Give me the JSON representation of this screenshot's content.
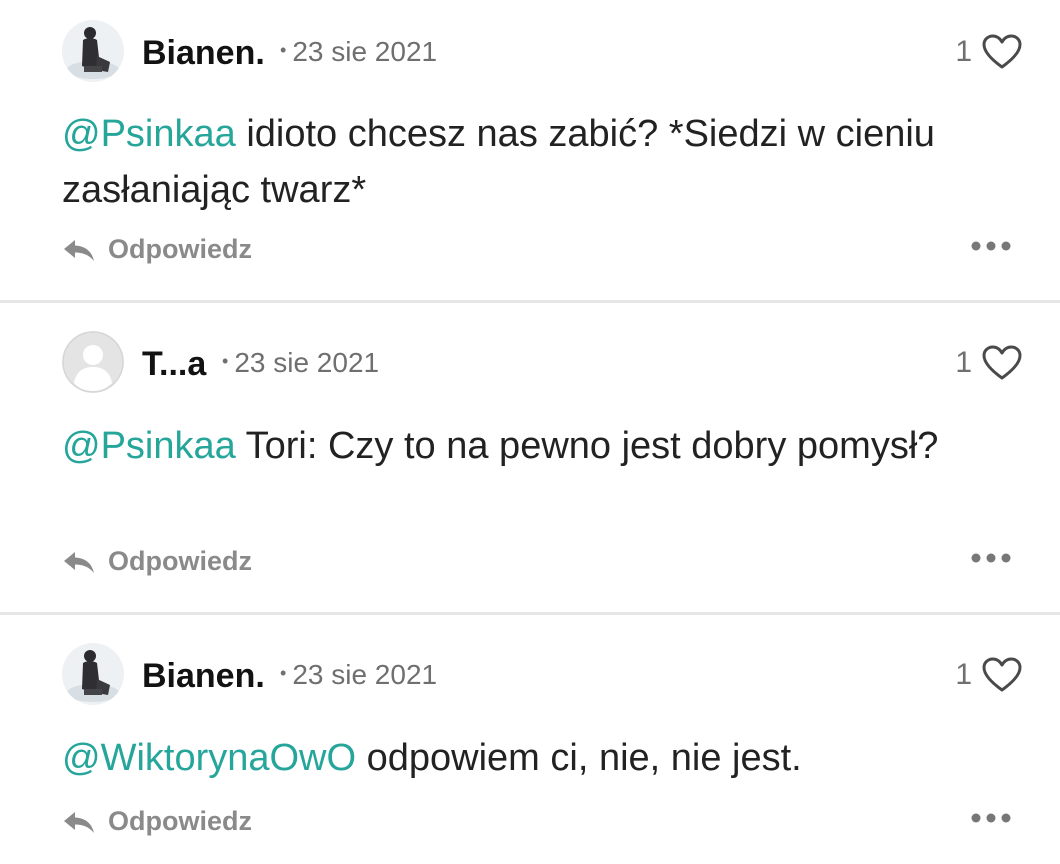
{
  "comments": [
    {
      "username": "Bianen.",
      "separator": "•",
      "date": "23 sie 2021",
      "likes": "1",
      "mention": "@Psinkaa",
      "text": " idioto chcesz nas zabić? *Siedzi w cieniu zasłaniając twarz*",
      "reply_label": "Odpowiedz",
      "avatar_icon": "user-photo-avatar-icon"
    },
    {
      "username": "T...a",
      "separator": "•",
      "date": "23 sie 2021",
      "likes": "1",
      "mention": "@Psinkaa",
      "text": " Tori: Czy to na pewno jest dobry pomysł?",
      "reply_label": "Odpowiedz",
      "avatar_icon": "default-avatar-icon"
    },
    {
      "username": "Bianen.",
      "separator": "•",
      "date": "23 sie 2021",
      "likes": "1",
      "mention": "@WiktorynaOwO",
      "text": " odpowiem ci, nie, nie jest.",
      "reply_label": "Odpowiedz",
      "avatar_icon": "user-photo-avatar-icon"
    }
  ],
  "icons": {
    "like": "heart-icon",
    "reply": "reply-arrow-icon",
    "more": "more-dots-icon"
  },
  "colors": {
    "mention": "#26a69a",
    "text": "#222222",
    "meta": "#6f6f6f",
    "divider": "#e6e6e6"
  }
}
